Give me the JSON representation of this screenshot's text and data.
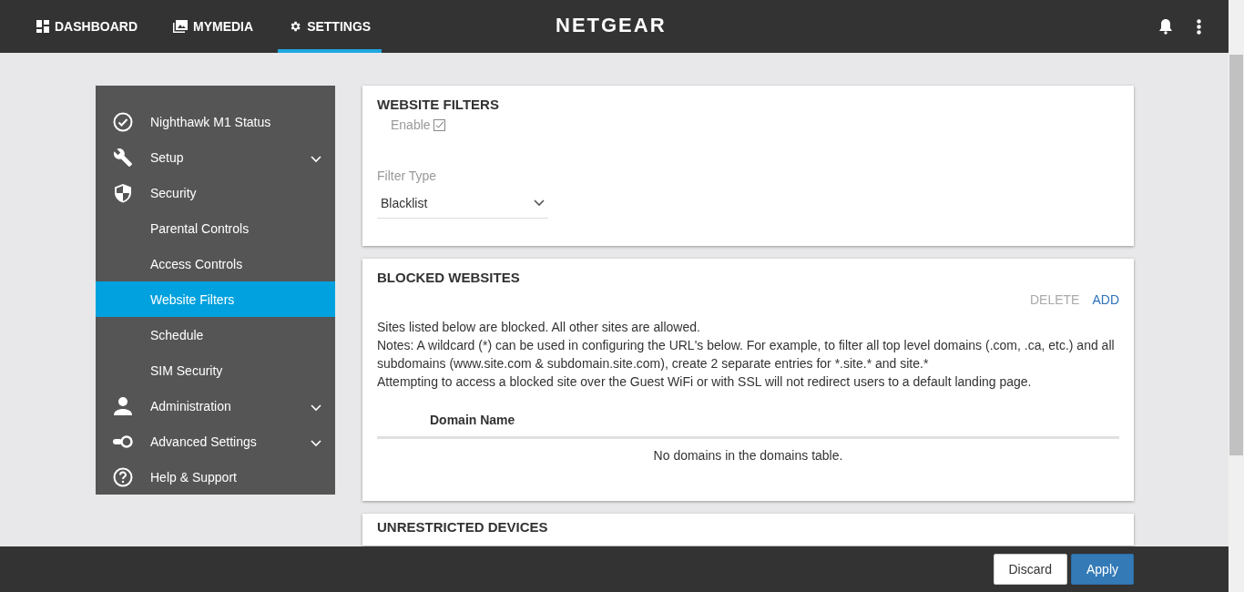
{
  "top_nav": {
    "tabs": [
      {
        "label": "DASHBOARD",
        "selected": false
      },
      {
        "label": "MYMEDIA",
        "selected": false
      },
      {
        "label": "SETTINGS",
        "selected": true
      }
    ],
    "logo": "NETGEAR"
  },
  "sidebar": {
    "items": [
      {
        "label": "Nighthawk M1 Status",
        "selected": false
      },
      {
        "label": "Setup",
        "selected": false,
        "collapsed": true
      },
      {
        "label": "Security",
        "selected": false,
        "collapsed": false,
        "children": [
          {
            "label": "Parental Controls",
            "selected": false
          },
          {
            "label": "Access Controls",
            "selected": false
          },
          {
            "label": "Website Filters",
            "selected": true
          },
          {
            "label": "Schedule",
            "selected": false
          },
          {
            "label": "SIM Security",
            "selected": false
          }
        ]
      },
      {
        "label": "Administration",
        "selected": false,
        "collapsed": true
      },
      {
        "label": "Advanced Settings",
        "selected": false,
        "collapsed": true
      },
      {
        "label": "Help & Support",
        "selected": false
      }
    ]
  },
  "website_filters": {
    "title": "WEBSITE FILTERS",
    "enable": {
      "label": "Enable",
      "checked": true
    },
    "filter_type": {
      "label": "Filter Type",
      "value": "Blacklist"
    }
  },
  "blocked_websites": {
    "title": "BLOCKED WEBSITES",
    "actions": [
      {
        "label": "DELETE",
        "disabled": true
      },
      {
        "label": "ADD",
        "disabled": false
      }
    ],
    "notes": [
      "Sites listed below are blocked. All other sites are allowed.",
      "Notes: A wildcard (*) can be used in configuring the URL's below. For example, to filter all top level domains (.com, .ca, etc.) and all subdomains (www.site.com & subdomain.site.com), create 2 separate entries for *.site.* and site.*",
      "Attempting to access a blocked site over the Guest WiFi or with SSL will not redirect users to a default landing page."
    ],
    "table": {
      "columns": [
        "Domain Name"
      ],
      "empty_message": "No domains in the domains table."
    }
  },
  "unrestricted_devices": {
    "title": "UNRESTRICTED DEVICES"
  },
  "footer": {
    "buttons": [
      {
        "label": "Discard",
        "kind": "secondary"
      },
      {
        "label": "Apply",
        "kind": "primary"
      }
    ]
  }
}
